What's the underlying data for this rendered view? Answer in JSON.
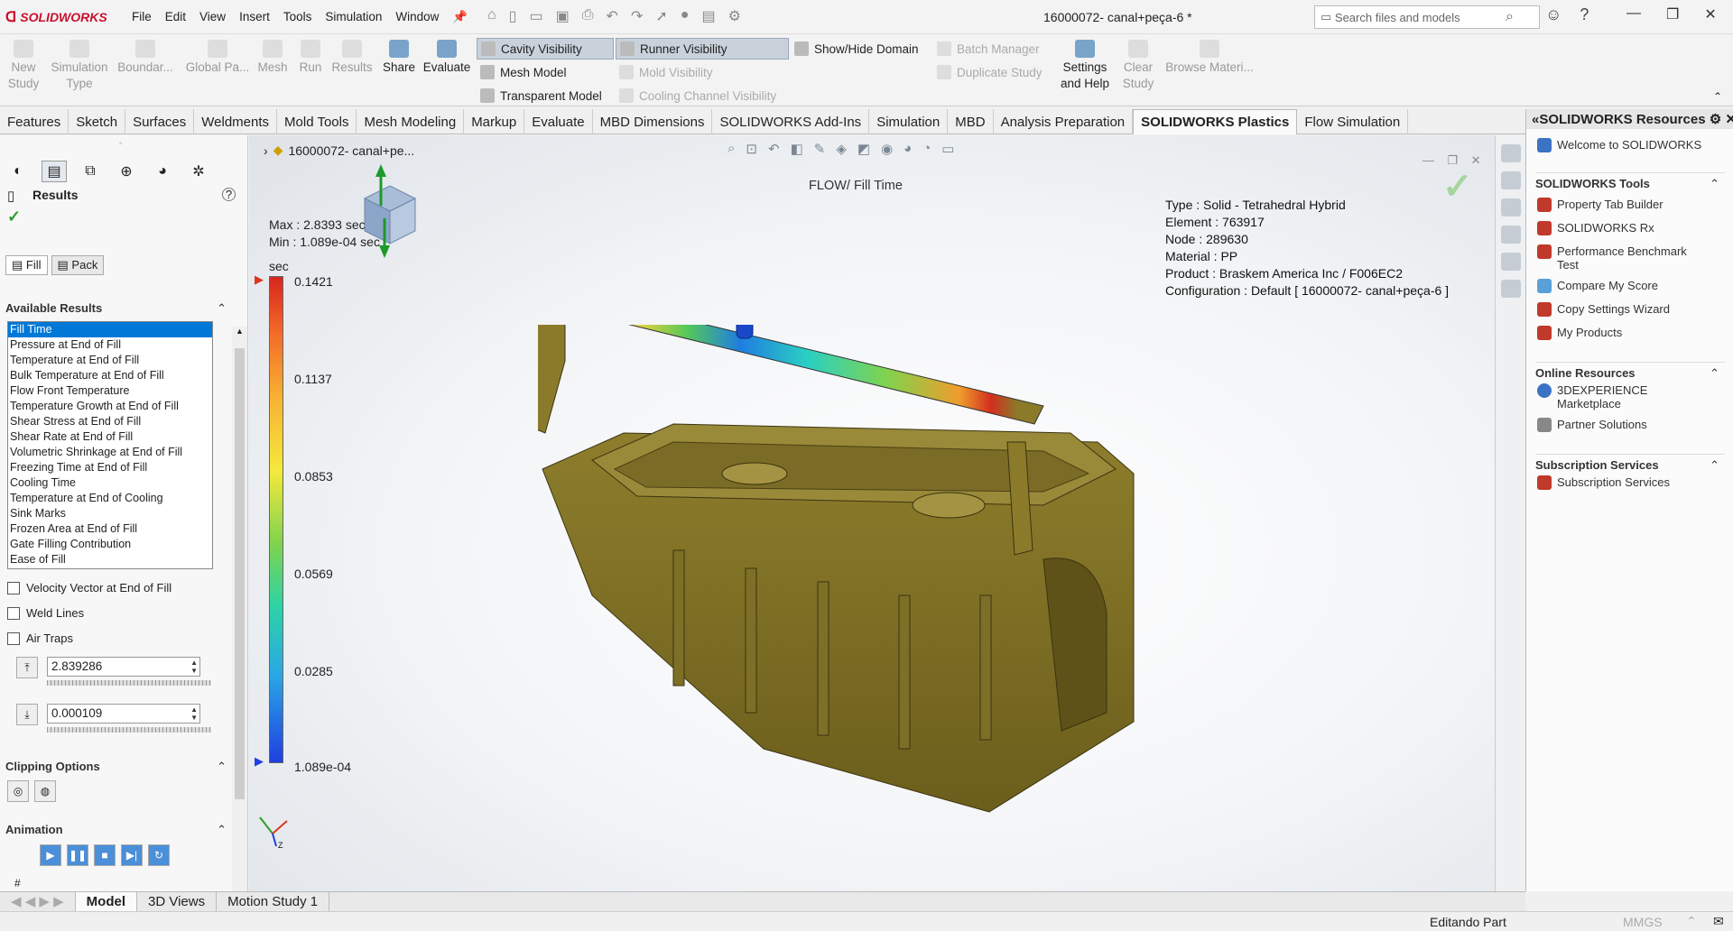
{
  "app": {
    "brand": "SOLIDWORKS",
    "doc_title": "16000072- canal+peça-6 *"
  },
  "menu": [
    "File",
    "Edit",
    "View",
    "Insert",
    "Tools",
    "Simulation",
    "Window"
  ],
  "search": {
    "placeholder": "Search files and models"
  },
  "ribbon": {
    "new_study": "New Study",
    "simulation_type": "Simulation Type",
    "boundary": "Boundar...",
    "global_pa": "Global Pa...",
    "mesh": "Mesh",
    "run": "Run",
    "results": "Results",
    "share": "Share",
    "evaluate": "Evaluate",
    "cavity_visibility": "Cavity Visibility",
    "runner_visibility": "Runner Visibility",
    "show_hide_domain": "Show/Hide Domain",
    "mesh_model": "Mesh Model",
    "mold_visibility": "Mold Visibility",
    "transparent_model": "Transparent Model",
    "cooling_channel_visibility": "Cooling Channel Visibility",
    "batch_manager": "Batch Manager",
    "duplicate_study": "Duplicate Study",
    "settings_help": "Settings and Help",
    "clear_study": "Clear Study",
    "browse_materi": "Browse Materi..."
  },
  "command_tabs": [
    "Features",
    "Sketch",
    "Surfaces",
    "Weldments",
    "Mold Tools",
    "Mesh Modeling",
    "Markup",
    "Evaluate",
    "MBD Dimensions",
    "SOLIDWORKS Add-Ins",
    "Simulation",
    "MBD",
    "Analysis Preparation",
    "SOLIDWORKS Plastics",
    "Flow Simulation"
  ],
  "active_tab": "SOLIDWORKS Plastics",
  "left": {
    "title": "Results",
    "fill_tab": "Fill",
    "pack_tab": "Pack",
    "available_results": "Available Results",
    "results_list": [
      "Fill Time",
      "Pressure at End of Fill",
      "Temperature at End of Fill",
      "Bulk Temperature at End of Fill",
      "Flow Front Temperature",
      "Temperature Growth at End of Fill",
      "Shear Stress at End of Fill",
      "Shear Rate at End of Fill",
      "Volumetric Shrinkage at End of Fill",
      "Freezing Time at End of Fill",
      "Cooling Time",
      "Temperature at End of Cooling",
      "Sink Marks",
      "Frozen Area at End of Fill",
      "Gate Filling Contribution",
      "Ease of Fill"
    ],
    "velocity_vector": "Velocity Vector at End of Fill",
    "weld_lines": "Weld Lines",
    "air_traps": "Air Traps",
    "max_value": "2.839286",
    "min_value": "0.000109",
    "clipping_options": "Clipping Options",
    "animation": "Animation"
  },
  "viewport": {
    "tree_label": "16000072- canal+pe...",
    "chart_title": "FLOW/ Fill Time",
    "max_text": "Max : 2.8393 sec",
    "min_text": "Min : 1.089e-04 sec",
    "unit": "sec",
    "legend_ticks": [
      "0.1421",
      "0.1137",
      "0.0853",
      "0.0569",
      "0.0285",
      "1.089e-04"
    ],
    "info": {
      "type": "Type : Solid - Tetrahedral Hybrid",
      "element": "Element : 763917",
      "node": "Node : 289630",
      "material": "Material : PP",
      "product": "Product : Braskem America Inc / F006EC2",
      "configuration": "Configuration : Default [ 16000072- canal+peça-6 ]"
    },
    "part_color": "#8a7a2a",
    "triad_label": "Z"
  },
  "taskpane": {
    "title": "SOLIDWORKS Resources",
    "welcome": "Welcome to SOLIDWORKS",
    "tools_title": "SOLIDWORKS Tools",
    "tools": [
      "Property Tab Builder",
      "SOLIDWORKS Rx",
      "Performance Benchmark Test",
      "Compare My Score",
      "Copy Settings Wizard",
      "My Products"
    ],
    "online_title": "Online Resources",
    "online": [
      "3DEXPERIENCE Marketplace",
      "Partner Solutions"
    ],
    "subs_title": "Subscription Services",
    "subs": [
      "Subscription Services"
    ]
  },
  "bottom_tabs": [
    "Model",
    "3D Views",
    "Motion Study 1"
  ],
  "status": {
    "left": "Editando Part",
    "units": "MMGS"
  }
}
